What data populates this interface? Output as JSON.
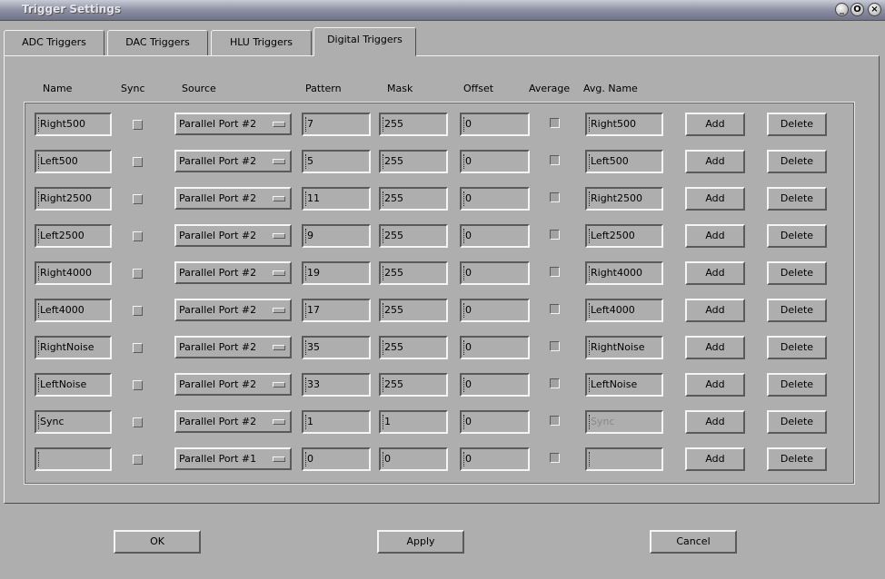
{
  "window": {
    "title": "Trigger Settings",
    "buttons": [
      "_",
      "O",
      "×"
    ]
  },
  "tabs": [
    {
      "label": "ADC Triggers",
      "active": false
    },
    {
      "label": "DAC Triggers",
      "active": false
    },
    {
      "label": "HLU Triggers",
      "active": false
    },
    {
      "label": "Digital Triggers",
      "active": true
    }
  ],
  "columns": {
    "name": "Name",
    "sync": "Sync",
    "source": "Source",
    "pattern": "Pattern",
    "mask": "Mask",
    "offset": "Offset",
    "average": "Average",
    "avg_name": "Avg. Name"
  },
  "rows": [
    {
      "name": "Right500",
      "source": "Parallel Port #2",
      "pattern": "7",
      "mask": "255",
      "offset": "0",
      "avg_name": "Right500",
      "avg_name_enabled": true,
      "add": "Add",
      "delete": "Delete"
    },
    {
      "name": "Left500",
      "source": "Parallel Port #2",
      "pattern": "5",
      "mask": "255",
      "offset": "0",
      "avg_name": "Left500",
      "avg_name_enabled": true,
      "add": "Add",
      "delete": "Delete"
    },
    {
      "name": "Right2500",
      "source": "Parallel Port #2",
      "pattern": "11",
      "mask": "255",
      "offset": "0",
      "avg_name": "Right2500",
      "avg_name_enabled": true,
      "add": "Add",
      "delete": "Delete"
    },
    {
      "name": "Left2500",
      "source": "Parallel Port #2",
      "pattern": "9",
      "mask": "255",
      "offset": "0",
      "avg_name": "Left2500",
      "avg_name_enabled": true,
      "add": "Add",
      "delete": "Delete"
    },
    {
      "name": "Right4000",
      "source": "Parallel Port #2",
      "pattern": "19",
      "mask": "255",
      "offset": "0",
      "avg_name": "Right4000",
      "avg_name_enabled": true,
      "add": "Add",
      "delete": "Delete"
    },
    {
      "name": "Left4000",
      "source": "Parallel Port #2",
      "pattern": "17",
      "mask": "255",
      "offset": "0",
      "avg_name": "Left4000",
      "avg_name_enabled": true,
      "add": "Add",
      "delete": "Delete"
    },
    {
      "name": "RightNoise",
      "source": "Parallel Port #2",
      "pattern": "35",
      "mask": "255",
      "offset": "0",
      "avg_name": "RightNoise",
      "avg_name_enabled": true,
      "add": "Add",
      "delete": "Delete"
    },
    {
      "name": "LeftNoise",
      "source": "Parallel Port #2",
      "pattern": "33",
      "mask": "255",
      "offset": "0",
      "avg_name": "LeftNoise",
      "avg_name_enabled": true,
      "add": "Add",
      "delete": "Delete"
    },
    {
      "name": "Sync",
      "source": "Parallel Port #2",
      "pattern": "1",
      "mask": "1",
      "offset": "0",
      "avg_name": "Sync",
      "avg_name_enabled": false,
      "add": "Add",
      "delete": "Delete"
    },
    {
      "name": "",
      "source": "Parallel Port #1",
      "pattern": "0",
      "mask": "0",
      "offset": "0",
      "avg_name": "",
      "avg_name_enabled": true,
      "add": "Add",
      "delete": "Delete"
    }
  ],
  "footer": {
    "ok": "OK",
    "apply": "Apply",
    "cancel": "Cancel"
  }
}
